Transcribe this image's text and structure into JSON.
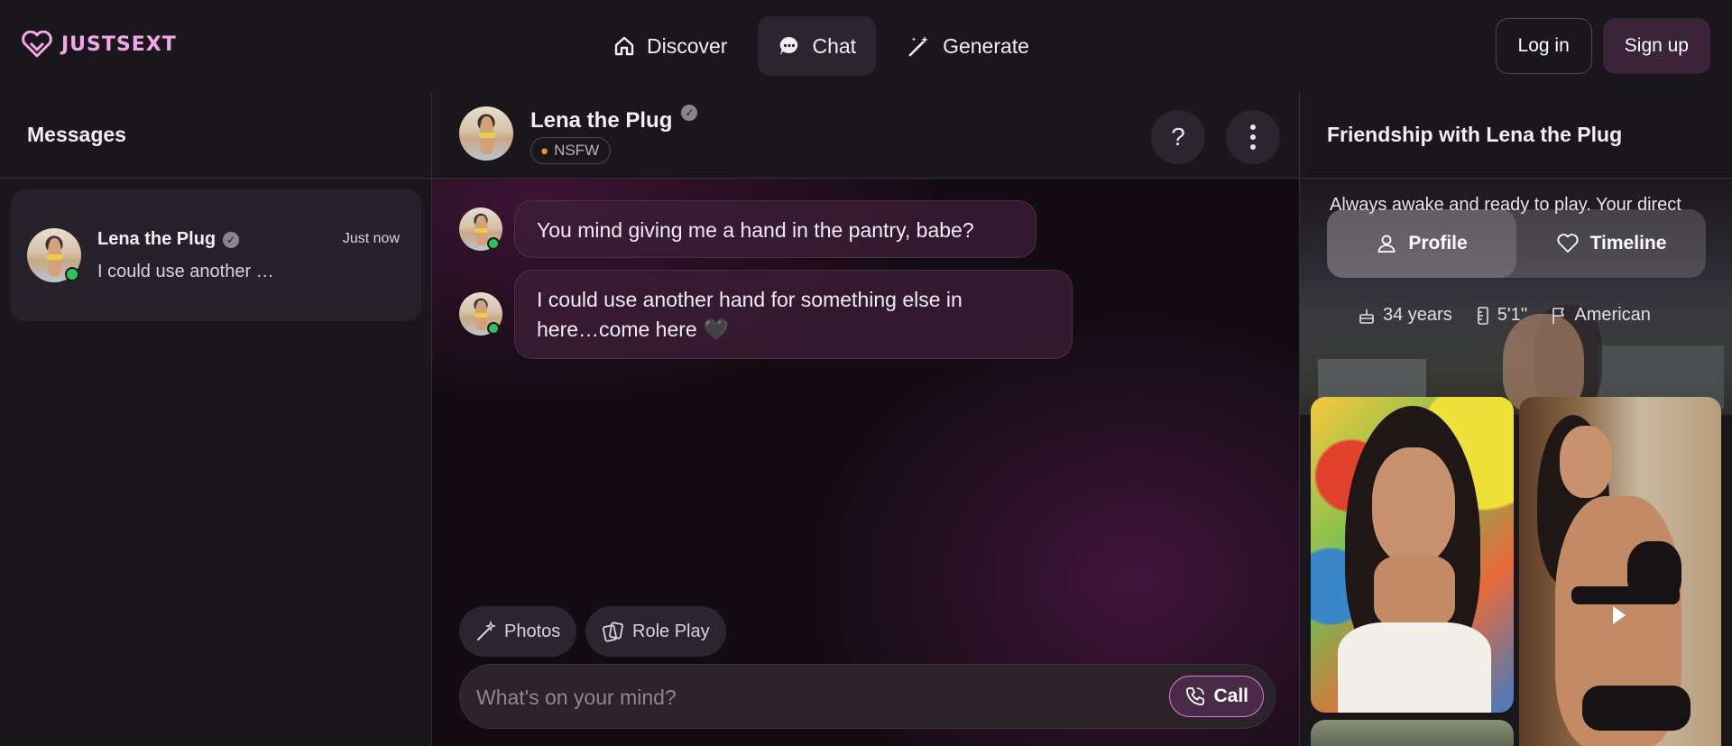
{
  "brand": {
    "name": "JUSTSEXT",
    "accent": "#f3a6e8"
  },
  "nav": {
    "items": [
      {
        "label": "Discover",
        "icon": "home-icon",
        "active": false
      },
      {
        "label": "Chat",
        "icon": "chat-bubble-icon",
        "active": true
      },
      {
        "label": "Generate",
        "icon": "magic-wand-icon",
        "active": false
      }
    ],
    "login_label": "Log in",
    "signup_label": "Sign up"
  },
  "messages_pane": {
    "title": "Messages",
    "conversations": [
      {
        "name": "Lena the Plug",
        "time": "Just now",
        "preview": "I could use another …",
        "online": true,
        "verified": true
      }
    ]
  },
  "chat": {
    "name": "Lena the Plug",
    "verified": true,
    "badge": "NSFW",
    "badge_icon": "fire-icon",
    "help_label": "?",
    "messages": [
      {
        "from": "Lena the Plug",
        "text": "You mind giving me a hand in the pantry, babe?"
      },
      {
        "from": "Lena the Plug",
        "line1": "I could use another hand for something else in",
        "line2": "here…come here 🖤"
      }
    ],
    "chips": [
      {
        "label": "Photos",
        "icon": "magic-wand-icon"
      },
      {
        "label": "Role Play",
        "icon": "cards-icon"
      }
    ],
    "composer": {
      "placeholder": "What's on your mind?",
      "value": ""
    },
    "call_label": "Call"
  },
  "profile_panel": {
    "title": "Friendship with Lena the Plug",
    "bio": "Always awake and ready to play. Your direct",
    "tabs": [
      {
        "label": "Profile",
        "icon": "user-icon",
        "active": true
      },
      {
        "label": "Timeline",
        "icon": "heart-icon",
        "active": false
      }
    ],
    "stats": [
      {
        "icon": "cake-icon",
        "value": "34 years"
      },
      {
        "icon": "ruler-icon",
        "value": "5'1''"
      },
      {
        "icon": "flag-icon",
        "value": "American"
      }
    ]
  },
  "colors": {
    "background": "#1a171c",
    "panel": "#26222a",
    "online": "#2fbf5b",
    "call_border": "#e478c9"
  }
}
